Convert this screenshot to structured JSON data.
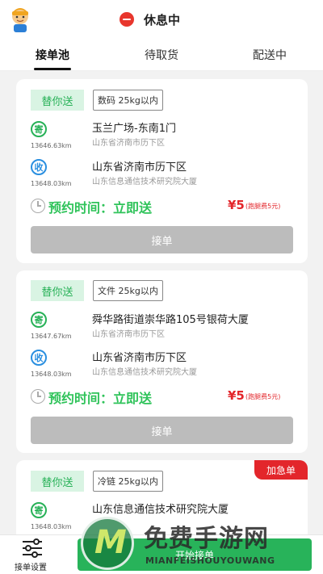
{
  "header": {
    "status_text": "休息中",
    "avatar_icon": "courier-avatar-icon",
    "status_color": "#e8362d"
  },
  "tabs": [
    {
      "label": "接单池",
      "active": true
    },
    {
      "label": "待取货",
      "active": false
    },
    {
      "label": "配送中",
      "active": false
    }
  ],
  "orders": [
    {
      "service_tag": "替你送",
      "cargo": "数码 25kg以内",
      "sender": {
        "badge": "寄",
        "distance": "13646.63km",
        "title": "玉兰广场-东南1门",
        "subtitle": "山东省济南市历下区"
      },
      "receiver": {
        "badge": "收",
        "distance": "13648.03km",
        "title": "山东省济南市历下区",
        "subtitle": "山东信息通信技术研究院大厦"
      },
      "appointment": "预约时间：立即送",
      "price": "¥5",
      "fee_note": "(跑腿费5元)",
      "accept_label": "接单"
    },
    {
      "service_tag": "替你送",
      "cargo": "文件 25kg以内",
      "sender": {
        "badge": "寄",
        "distance": "13647.67km",
        "title": "舜华路街道崇华路105号银荷大厦",
        "subtitle": "山东省济南市历下区"
      },
      "receiver": {
        "badge": "收",
        "distance": "13648.03km",
        "title": "山东省济南市历下区",
        "subtitle": "山东信息通信技术研究院大厦"
      },
      "appointment": "预约时间：立即送",
      "price": "¥5",
      "fee_note": "(跑腿费5元)",
      "accept_label": "接单"
    },
    {
      "service_tag": "替你送",
      "cargo": "冷链 25kg以内",
      "urgent_label": "加急单",
      "sender": {
        "badge": "寄",
        "distance": "13648.03km",
        "title": "山东信息通信技术研究院大厦",
        "subtitle": ""
      }
    }
  ],
  "bottom": {
    "settings_label": "接单设置",
    "start_label": "开始接单"
  },
  "watermark": {
    "logo_letter": "M",
    "title": "免费手游网",
    "subtitle": "MIANFEISHOUYOUWANG"
  },
  "colors": {
    "accent_green": "#28b35a",
    "price_red": "#e3262b",
    "receive_blue": "#2a8fe0"
  }
}
